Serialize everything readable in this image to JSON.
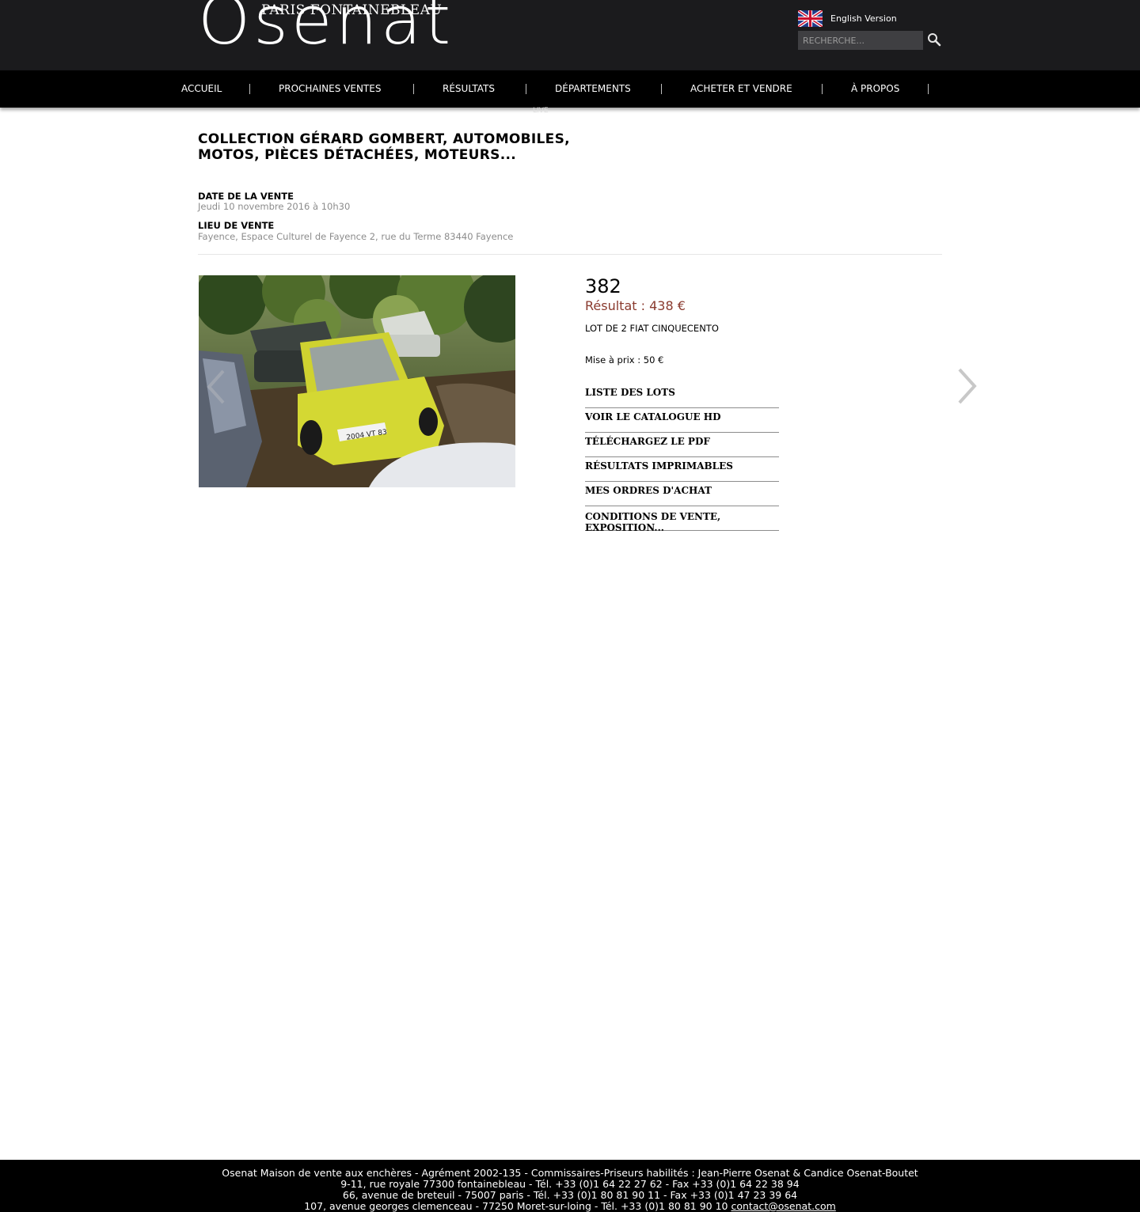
{
  "header": {
    "logo_top": "PARIS FONTAINEBLEAU",
    "logo_main": "Osenat",
    "language_label": "English Version",
    "search_placeholder": "RECHERCHE..."
  },
  "nav": {
    "items": [
      "ACCUEIL",
      "PROCHAINES VENTES",
      "RÉSULTATS",
      "DÉPARTEMENTS",
      "ACHETER ET VENDRE",
      "À PROPOS"
    ],
    "live_label": "LIVE"
  },
  "sale": {
    "title": "COLLECTION GÉRARD GOMBERT, AUTOMOBILES, MOTOS, PIÈCES DÉTACHÉES, MOTEURS...",
    "date_label": "DATE DE LA VENTE",
    "date_value": "Jeudi 10 novembre 2016 à 10h30",
    "place_label": "LIEU DE VENTE",
    "place_value": "Fayence, Espace Culturel de Fayence 2, rue du Terme 83440 Fayence"
  },
  "lot": {
    "number": "382",
    "result": "Résultat : 438 €",
    "description": "LOT DE 2 FIAT CINQUECENTO",
    "estimate": "Mise à prix : 50 €",
    "plate_text": "2004 VT 83"
  },
  "links": [
    "LISTE DES LOTS",
    "VOIR LE CATALOGUE HD",
    "TÉLÉCHARGEZ LE PDF",
    "RÉSULTATS IMPRIMABLES",
    "MES ORDRES D'ACHAT",
    "CONDITIONS DE VENTE, EXPOSITION..."
  ],
  "footer": {
    "line1": "Osenat Maison de vente aux enchères - Agrément 2002-135 - Commissaires-Priseurs habilités : Jean-Pierre Osenat & Candice Osenat-Boutet",
    "line2": "9-11, rue royale 77300 fontainebleau - Tél. +33 (0)1 64 22 27 62 - Fax +33 (0)1 64 22 38 94",
    "line3": "66, avenue de breteuil - 75007 paris - Tél. +33 (0)1 80 81 90 11 - Fax +33 (0)1 47 23 39 64",
    "line4": "107, avenue georges clemenceau - 77250 Moret-sur-loing - Tél. +33 (0)1 80 81 90 10",
    "email": "contact@osenat.com"
  },
  "colors": {
    "header_bg": "#1b1b1d",
    "nav_bg": "#000000",
    "result_accent": "#8a3a2e",
    "secondary_text": "#8c8c8c"
  },
  "icons": {
    "flag": "uk-flag-icon",
    "search": "search-icon",
    "prev": "chevron-left-icon",
    "next": "chevron-right-icon"
  }
}
